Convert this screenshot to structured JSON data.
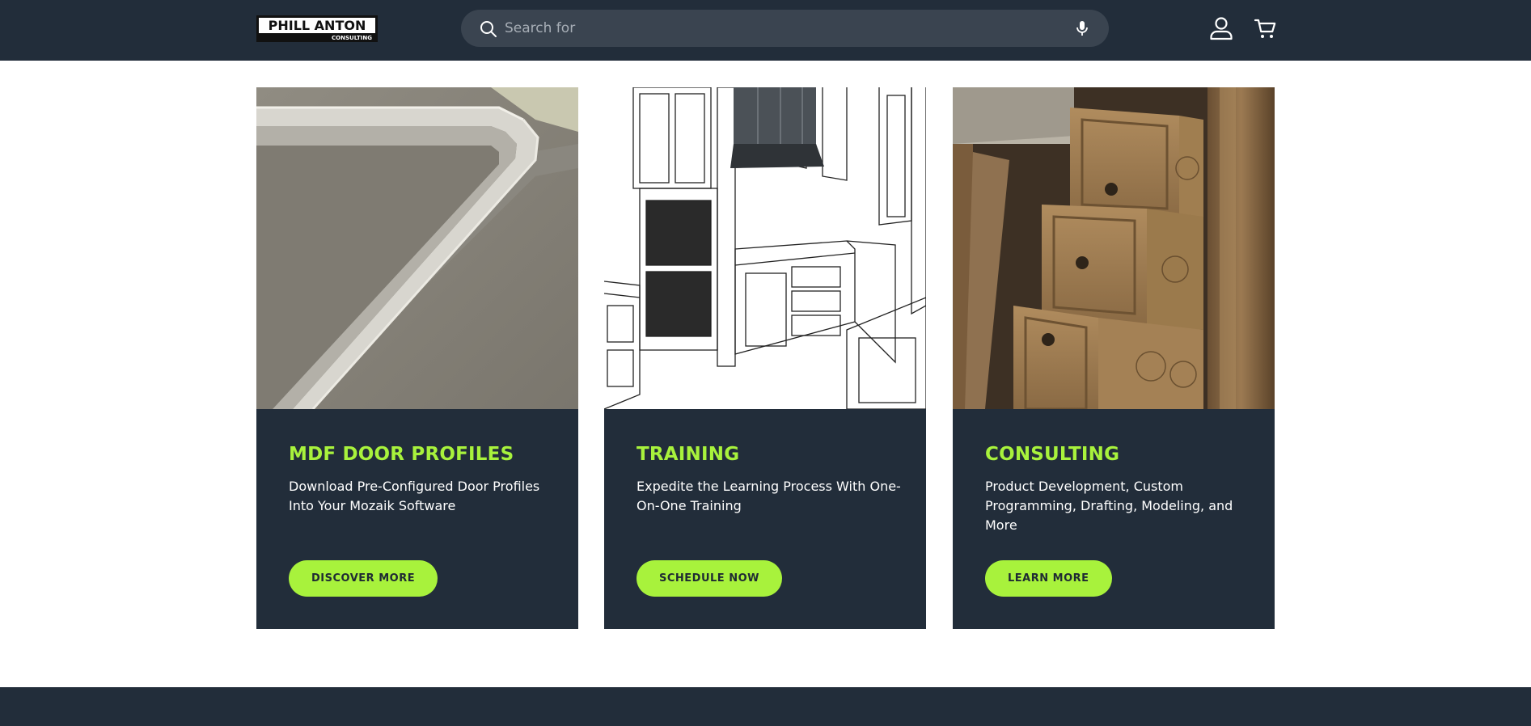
{
  "header": {
    "logo": {
      "line1": "PHILL ANTON",
      "line2": "CONSULTING"
    },
    "search": {
      "placeholder": "Search for"
    },
    "icons": [
      "search-icon",
      "microphone-icon",
      "account-icon",
      "cart-icon"
    ]
  },
  "cards": [
    {
      "title": "MDF DOOR PROFILES",
      "description": "Download Pre-Configured Door Profiles Into Your Mozaik Software",
      "button": "DISCOVER MORE"
    },
    {
      "title": "TRAINING",
      "description": "Expedite the Learning Process With One-On-One Training",
      "button": "SCHEDULE NOW"
    },
    {
      "title": "CONSULTING",
      "description": "Product Development, Custom Programming, Drafting, Modeling, and More",
      "button": "LEARN MORE"
    }
  ],
  "colors": {
    "navy": "#222d3a",
    "accent": "#a8f23c",
    "search_bg": "#3a4450"
  }
}
